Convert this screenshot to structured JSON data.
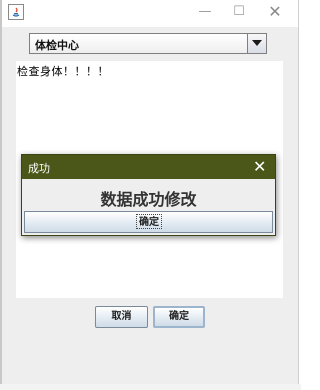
{
  "window": {
    "title_icon": "java-app-icon",
    "min_glyph": "—",
    "max_glyph": "☐",
    "close_glyph": "✕"
  },
  "combo": {
    "selected": "体检中心",
    "arrow_icon": "chevron-down-icon"
  },
  "textarea": {
    "text": "检查身体！！！！"
  },
  "buttons": {
    "cancel": "取消",
    "ok": "确定"
  },
  "dialog": {
    "title": "成功",
    "close_glyph": "✕",
    "message": "数据成功修改",
    "ok": "确定",
    "title_color": "#4b5718"
  }
}
